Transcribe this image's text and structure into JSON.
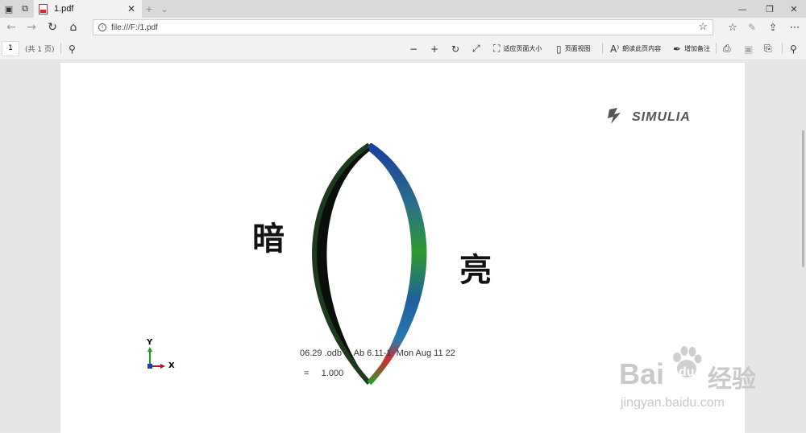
{
  "browser": {
    "tab_title": "1.pdf",
    "address": "file:///F:/1.pdf",
    "window_buttons": {
      "minimize": "—",
      "restore": "❐",
      "close": "✕"
    }
  },
  "pdf_toolbar": {
    "current_page": "1",
    "page_total": "(共 1 页)",
    "fit_page_label": "适应页面大小",
    "page_view_label": "页面视图",
    "read_aloud_label": "朗读此页内容",
    "add_notes_label": "增加备注"
  },
  "document": {
    "logo_text": "SIMULIA",
    "label_dark": "暗",
    "label_bright": "亮",
    "axis_y": "Y",
    "axis_x": "X",
    "legend_line1": "06.29 .odb     Ab 6.11-1  Mon Aug 11 22",
    "legend_line2": "=     1.000"
  },
  "watermark": {
    "brand": "Bai",
    "brand2": "du",
    "jingyan": "经验",
    "url": "jingyan.baidu.com"
  },
  "colors": {
    "accent_red": "#d22b2b",
    "shell_dark": "#0a0f0a",
    "shell_green": "#2f9a2f",
    "shell_blue": "#1b3da0"
  }
}
